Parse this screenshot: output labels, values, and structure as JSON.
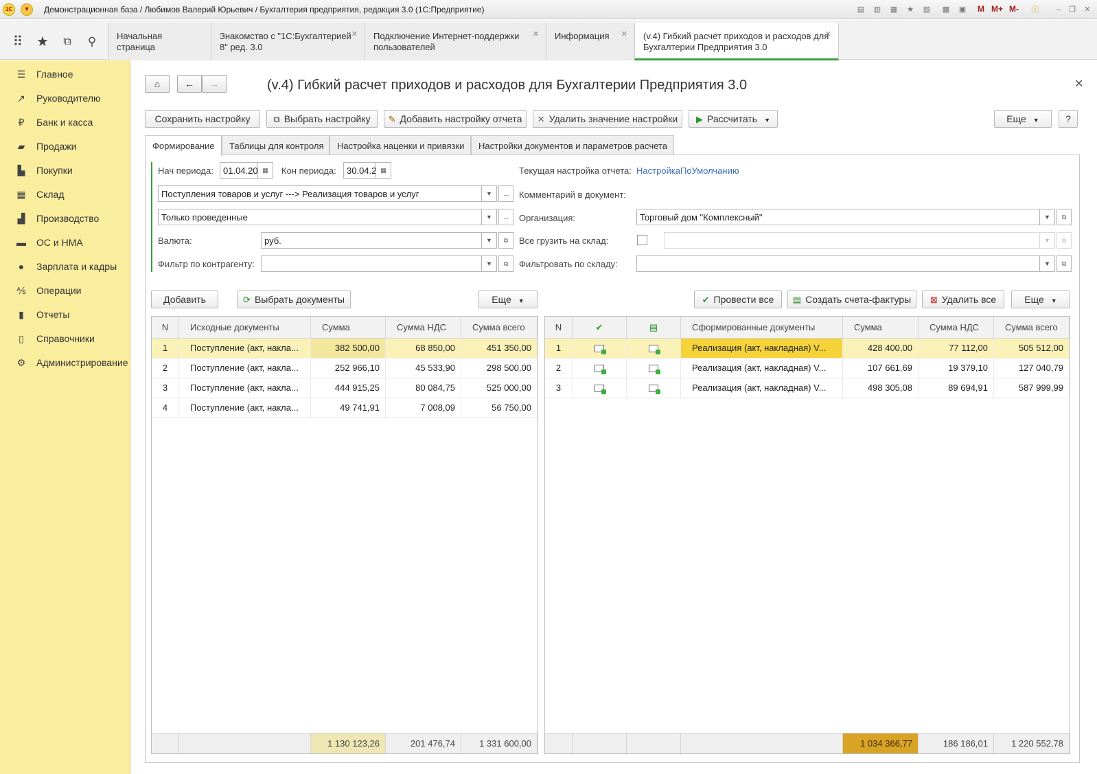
{
  "window": {
    "title": "Демонстрационная база / Любимов Валерий Юрьевич / Бухгалтерия предприятия, редакция 3.0  (1С:Предприятие)",
    "logo": "1С",
    "m_buttons": [
      "M",
      "M+",
      "M-"
    ]
  },
  "top_tabs": [
    {
      "label": "Начальная страница",
      "closable": false
    },
    {
      "label": "Знакомство с \"1С:Бухгалтерией 8\" ред. 3.0",
      "closable": true
    },
    {
      "label": "Подключение Интернет-поддержки пользователей",
      "closable": true
    },
    {
      "label": "Информация",
      "closable": true
    },
    {
      "label": "(v.4) Гибкий расчет приходов и расходов для Бухгалтерии Предприятия 3.0",
      "closable": true,
      "active": true
    }
  ],
  "sidebar": {
    "items": [
      {
        "label": "Главное",
        "icon": "menu-icon"
      },
      {
        "label": "Руководителю",
        "icon": "trend-icon"
      },
      {
        "label": "Банк и касса",
        "icon": "ruble-icon"
      },
      {
        "label": "Продажи",
        "icon": "bag-icon"
      },
      {
        "label": "Покупки",
        "icon": "cart-icon"
      },
      {
        "label": "Склад",
        "icon": "warehouse-icon"
      },
      {
        "label": "Производство",
        "icon": "factory-icon"
      },
      {
        "label": "ОС и НМА",
        "icon": "truck-icon"
      },
      {
        "label": "Зарплата и кадры",
        "icon": "person-icon"
      },
      {
        "label": "Операции",
        "icon": "operations-icon"
      },
      {
        "label": "Отчеты",
        "icon": "chart-icon"
      },
      {
        "label": "Справочники",
        "icon": "book-icon"
      },
      {
        "label": "Администрирование",
        "icon": "gear-icon"
      }
    ]
  },
  "form": {
    "title": "(v.4) Гибкий расчет приходов и расходов для Бухгалтерии Предприятия 3.0",
    "toolbar": {
      "save_setting": "Сохранить настройку",
      "select_setting": "Выбрать настройку",
      "add_report_setting": "Добавить настройку отчета",
      "delete_setting_value": "Удалить значение настройки",
      "calculate": "Рассчитать",
      "more": "Еще",
      "help": "?"
    },
    "tabs": [
      "Формирование",
      "Таблицы для контроля",
      "Настройка наценки и привязки",
      "Настройки документов и параметров расчета"
    ],
    "fields": {
      "period_start_label": "Нач периода:",
      "period_start_value": "01.04.20",
      "period_end_label": "Кон периода:",
      "period_end_value": "30.04.2",
      "mode_value": "Поступления товаров и услуг ---> Реализация товаров и услуг",
      "posted_value": "Только проведенные",
      "currency_label": "Валюта:",
      "currency_value": "руб.",
      "counterparty_filter_label": "Фильтр по контрагенту:",
      "counterparty_filter_value": "",
      "current_setting_label": "Текущая настройка отчета:",
      "current_setting_value": "НастройкаПоУмолчанию",
      "comment_label": "Комментарий в документ:",
      "org_label": "Организация:",
      "org_value": "Торговый дом \"Комплексный\"",
      "load_all_warehouse_label": "Все грузить на склад:",
      "warehouse_filter_label": "Фильтровать по складу:",
      "ellipsis": "..."
    },
    "left_toolbar": {
      "add": "Добавить",
      "select_docs": "Выбрать документы",
      "more": "Еще"
    },
    "right_toolbar": {
      "post_all": "Провести все",
      "create_invoices": "Создать счета-фактуры",
      "delete_all": "Удалить все",
      "more": "Еще"
    },
    "left_table": {
      "headers": [
        "N",
        "Исходные документы",
        "Сумма",
        "Сумма НДС",
        "Сумма всего"
      ],
      "rows": [
        [
          "1",
          "Поступление (акт, накла...",
          "382 500,00",
          "68 850,00",
          "451 350,00"
        ],
        [
          "2",
          "Поступление (акт, накла...",
          "252 966,10",
          "45 533,90",
          "298 500,00"
        ],
        [
          "3",
          "Поступление (акт, накла...",
          "444 915,25",
          "80 084,75",
          "525 000,00"
        ],
        [
          "4",
          "Поступление (акт, накла...",
          "49 741,91",
          "7 008,09",
          "56 750,00"
        ]
      ],
      "totals": [
        "1 130 123,26",
        "201 476,74",
        "1 331 600,00"
      ]
    },
    "right_table": {
      "headers": [
        "N",
        "",
        "",
        "Сформированные документы",
        "Сумма",
        "Сумма НДС",
        "Сумма всего"
      ],
      "rows": [
        [
          "1",
          "Реализация (акт, накладная) V...",
          "428 400,00",
          "77 112,00",
          "505 512,00"
        ],
        [
          "2",
          "Реализация (акт, накладная) V...",
          "107 661,69",
          "19 379,10",
          "127 040,79"
        ],
        [
          "3",
          "Реализация (акт, накладная) V...",
          "498 305,08",
          "89 694,91",
          "587 999,99"
        ]
      ],
      "totals": [
        "1 034 366,77",
        "186 186,01",
        "1 220 552,78"
      ]
    },
    "colors": {
      "sidebar": "#fbed9e",
      "selected_row": "#fbf2b8",
      "selected_cell": "#f7d33a",
      "accent_green": "#3f9f3f",
      "link": "#3b6fba",
      "total_highlight": "#d9a326"
    }
  }
}
